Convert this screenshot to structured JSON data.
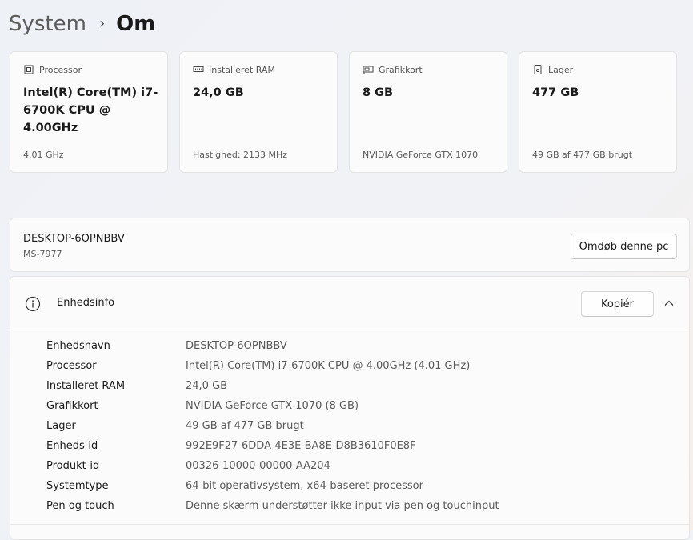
{
  "breadcrumb": {
    "parent": "System",
    "separator": "›",
    "current": "Om"
  },
  "cards": [
    {
      "label": "Processor",
      "value": "Intel(R) Core(TM) i7-6700K CPU @ 4.00GHz",
      "sub": "4.01 GHz",
      "icon": "processor-icon"
    },
    {
      "label": "Installeret RAM",
      "value": "24,0 GB",
      "sub": "Hastighed: 2133 MHz",
      "icon": "ram-icon"
    },
    {
      "label": "Grafikkort",
      "value": "8 GB",
      "sub": "NVIDIA GeForce GTX 1070",
      "icon": "graphics-card-icon"
    },
    {
      "label": "Lager",
      "value": "477 GB",
      "sub": "49 GB af 477 GB brugt",
      "icon": "storage-icon"
    }
  ],
  "device": {
    "name": "DESKTOP-6OPNBBV",
    "model": "MS-7977",
    "rename_label": "Omdøb denne pc"
  },
  "info": {
    "title": "Enhedsinfo",
    "copy_label": "Kopiér",
    "specs": [
      {
        "key": "Enhedsnavn",
        "value": "DESKTOP-6OPNBBV"
      },
      {
        "key": "Processor",
        "value": "Intel(R) Core(TM) i7-6700K CPU @ 4.00GHz (4.01 GHz)"
      },
      {
        "key": "Installeret RAM",
        "value": "24,0 GB"
      },
      {
        "key": "Grafikkort",
        "value": "NVIDIA GeForce GTX 1070 (8 GB)"
      },
      {
        "key": "Lager",
        "value": "49 GB af 477 GB brugt"
      },
      {
        "key": "Enheds-id",
        "value": "992E9F27-6DDA-4E3E-BA8E-D8B3610F0E8F"
      },
      {
        "key": "Produkt-id",
        "value": "00326-10000-00000-AA204"
      },
      {
        "key": "Systemtype",
        "value": "64-bit operativsystem, x64-baseret processor"
      },
      {
        "key": "Pen og touch",
        "value": "Denne skærm understøtter ikke input via pen og touchinput"
      }
    ]
  }
}
